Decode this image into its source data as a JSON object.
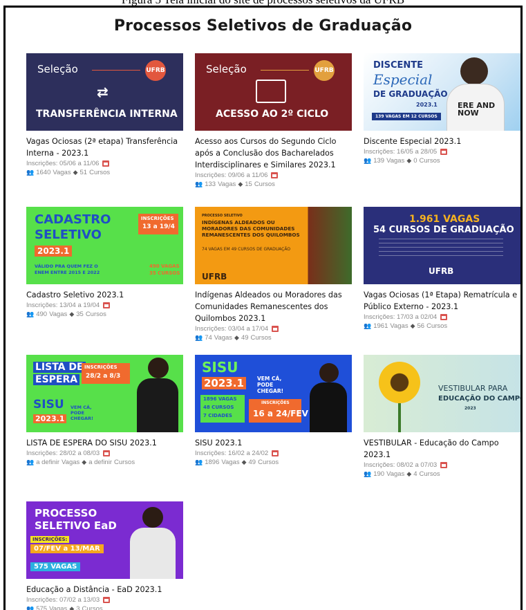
{
  "figure_caption": "Figura 5 Tela inicial do site de processos seletivos da UFRB",
  "page_title": "Processos Seletivos de Graduação",
  "labels": {
    "vagas": "Vagas",
    "cursos": "Cursos"
  },
  "cards": [
    {
      "title": "Vagas Ociosas (2ª etapa) Transferência Interna - 2023.1",
      "inscricoes": "Inscrições: 05/06 a 11/06",
      "vagas": "1640",
      "cursos": "51",
      "thumb": {
        "top": "Seleção",
        "bottom": "TRANSFERÊNCIA INTERNA",
        "logo": "UFRB"
      }
    },
    {
      "title": "Acesso aos Cursos do Segundo Ciclo após a Conclusão dos Bacharelados Interdisciplinares e Similares 2023.1",
      "inscricoes": "Inscrições: 09/06 a 11/06",
      "vagas": "133",
      "cursos": "15",
      "thumb": {
        "top": "Seleção",
        "bottom": "ACESSO AO 2º CICLO",
        "logo": "UFRB"
      }
    },
    {
      "title": "Discente Especial 2023.1",
      "inscricoes": "Inscrições: 16/05 a 28/05",
      "vagas": "139",
      "cursos": "0",
      "thumb": {
        "l1": "DISCENTE",
        "l2": "Especial",
        "l3": "DE GRADUAÇÃO",
        "l4": "2023.1",
        "l5": "139 VAGAS EM 12 CURSOS",
        "shirt": "ERE AND NOW"
      }
    },
    {
      "title": "Cadastro Seletivo 2023.1",
      "inscricoes": "Inscrições: 13/04 a 19/04",
      "vagas": "490",
      "cursos": "35",
      "thumb": {
        "l1": "CADASTRO",
        "l2": "SELETIVO",
        "l3": "2023.1",
        "l4": "VÁLIDO PRA QUEM FEZ O ENEM ENTRE 2015 E 2022",
        "ins1": "INSCRIÇÕES",
        "ins2": "13 a 19/4",
        "v1": "490 VAGAS",
        "v2": "35 CURSOS"
      }
    },
    {
      "title": "Indígenas Aldeados ou Moradores das Comunidades Remanescentes dos Quilombos 2023.1",
      "inscricoes": "Inscrições: 03/04 a 17/04",
      "vagas": "74",
      "cursos": "49",
      "thumb": {
        "l0": "PROCESSO SELETIVO",
        "l1": "INDÍGENAS ALDEADOS OU MORADORES DAS COMUNIDADES REMANESCENTES DOS QUILOMBOS",
        "l2": "74 VAGAS EM 49 CURSOS DE GRADUAÇÃO",
        "logo": "UFRB"
      }
    },
    {
      "title": "Vagas Ociosas (1ª Etapa) Rematrícula e Público Externo - 2023.1",
      "inscricoes": "Inscrições: 17/03 a 02/04",
      "vagas": "1961",
      "cursos": "56",
      "thumb": {
        "l1": "1.961 VAGAS",
        "l2": "54 CURSOS DE GRADUAÇÃO",
        "logo": "UFRB"
      }
    },
    {
      "title": "LISTA DE ESPERA DO SISU 2023.1",
      "inscricoes": "Inscrições: 28/02 a 08/03",
      "vagas": "a definir",
      "cursos": "a definir",
      "thumb": {
        "l1": "LISTA DE",
        "l2": "ESPERA",
        "ins1": "INSCRIÇÕES",
        "ins2": "28/2 a 8/3",
        "l3": "SISU",
        "l4": "2023.1",
        "l5": "VEM CÁ, PODE CHEGAR!"
      }
    },
    {
      "title": "SISU 2023.1",
      "inscricoes": "Inscrições: 16/02 a 24/02",
      "vagas": "1896",
      "cursos": "49",
      "thumb": {
        "l1": "SISU",
        "l2": "2023.1",
        "l3": "VEM CÁ, PODE CHEGAR!",
        "v1": "1896 VAGAS",
        "v2": "48 CURSOS",
        "v3": "7 CIDADES",
        "ins1": "INSCRIÇÕES",
        "ins2": "16 a 24/FEV"
      }
    },
    {
      "title": "VESTIBULAR - Educação do Campo 2023.1",
      "inscricoes": "Inscrições: 08/02 a 07/03",
      "vagas": "190",
      "cursos": "4",
      "thumb": {
        "l1": "VESTIBULAR PARA",
        "l2": "EDUCAÇÃO DO CAMPO",
        "l3": "2023"
      }
    },
    {
      "title": "Educação a Distância - EaD 2023.1",
      "inscricoes": "Inscrições: 07/02 a 13/03",
      "vagas": "575",
      "cursos": "3",
      "thumb": {
        "l1": "PROCESSO",
        "l2": "SELETIVO EaD",
        "ins1": "INSCRIÇÕES:",
        "ins2": "07/FEV a 13/MAR",
        "v1": "575 VAGAS"
      }
    }
  ]
}
